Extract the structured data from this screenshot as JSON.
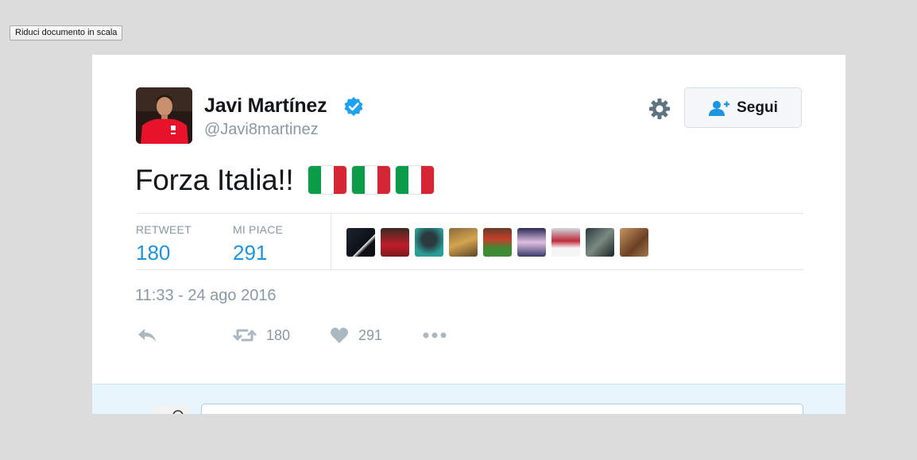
{
  "browser": {
    "shrink_button_label": "Riduci documento in scala"
  },
  "tweet": {
    "author_name": "Javi Martínez",
    "author_handle": "@Javi8martinez",
    "verified_icon": "verified-badge-icon",
    "follow_label": "Segui",
    "text": "Forza Italia!!",
    "flags": [
      "italy-flag-emoji",
      "italy-flag-emoji",
      "italy-flag-emoji"
    ],
    "stats": {
      "retweet_label": "RETWEET",
      "retweet_count": "180",
      "likes_label": "MI PIACE",
      "likes_count": "291"
    },
    "timestamp": "11:33 - 24 ago 2016",
    "actions": {
      "reply_icon": "reply-icon",
      "retweet_icon": "retweet-icon",
      "retweet_count": "180",
      "like_icon": "heart-icon",
      "like_count": "291",
      "more_icon": "more-dots-icon"
    }
  },
  "colors": {
    "accent": "#1b95e0",
    "muted": "#8899a6",
    "text": "#14171a",
    "flag_green": "#0a9c48",
    "flag_white": "#ffffff",
    "flag_red": "#d62535"
  }
}
